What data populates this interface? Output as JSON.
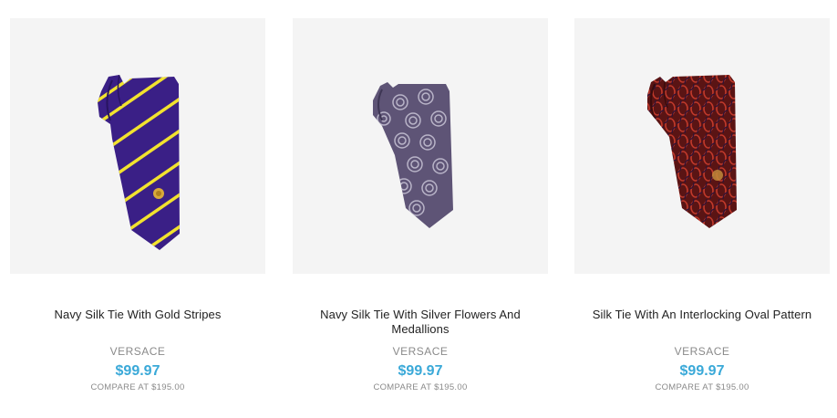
{
  "products": [
    {
      "title": "Navy Silk Tie With Gold Stripes",
      "vendor": "VERSACE",
      "price": "$99.97",
      "compare": "COMPARE AT $195.00",
      "image_desc": "navy-tie-gold-stripes-image"
    },
    {
      "title": "Navy Silk Tie With Silver Flowers And Medallions",
      "vendor": "VERSACE",
      "price": "$99.97",
      "compare": "COMPARE AT $195.00",
      "image_desc": "navy-tie-silver-medallions-image"
    },
    {
      "title": "Silk Tie With An Interlocking Oval Pattern",
      "vendor": "VERSACE",
      "price": "$99.97",
      "compare": "COMPARE AT $195.00",
      "image_desc": "red-tie-oval-pattern-image"
    }
  ],
  "colors": {
    "price": "#3aa9d8",
    "vendor": "#8a8a8a",
    "title": "#222222",
    "image_bg": "#f4f4f4"
  }
}
